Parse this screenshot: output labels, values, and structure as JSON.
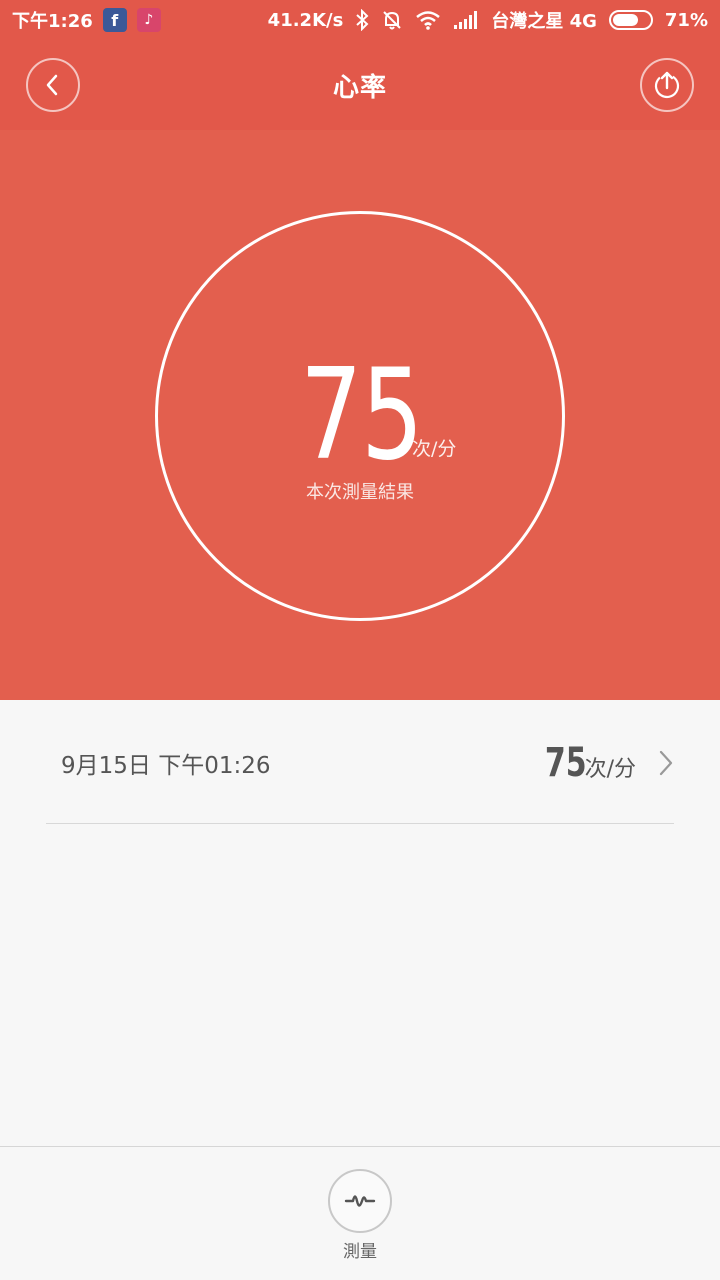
{
  "status_bar": {
    "time": "下午1:26",
    "app_badge_1": "f",
    "app_badge_2": "♪",
    "net_speed": "41.2K/s",
    "carrier": "台灣之星 4G",
    "battery": "71%",
    "battery_level": 0.71
  },
  "app_bar": {
    "title": "心率",
    "back_icon": "chevron-left-icon",
    "share_icon": "upload-icon"
  },
  "hero": {
    "value": "75",
    "unit": "次/分",
    "caption": "本次測量結果"
  },
  "records": [
    {
      "datetime": "9月15日 下午01:26",
      "value": "75",
      "unit": "次/分"
    }
  ],
  "bottom_bar": {
    "measure_label": "測量",
    "measure_icon": "pulse-wave-icon"
  },
  "colors": {
    "header": "#e2584a",
    "hero": "#e35f4e",
    "background": "#f7f7f7"
  }
}
